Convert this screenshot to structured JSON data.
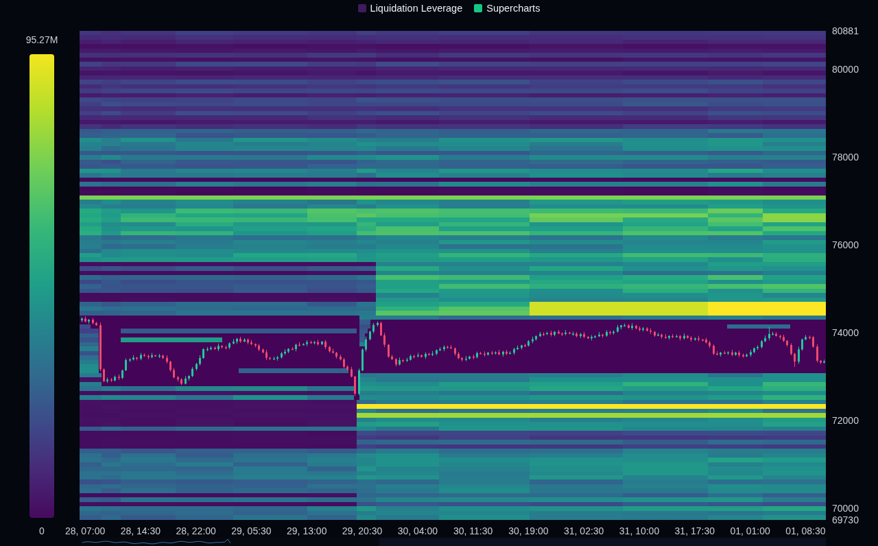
{
  "legend": {
    "items": [
      {
        "label": "Liquidation Leverage",
        "color": "#3f1a5e",
        "on": true
      },
      {
        "label": "Supercharts",
        "color": "#16c784",
        "on": true
      }
    ]
  },
  "color_scale": {
    "max_label": "95.27M",
    "min_label": "0"
  },
  "chart": {
    "chart_data": {
      "type": "candlestick",
      "ylim": [
        69730,
        80881
      ],
      "yticks": [
        80881,
        80000,
        78000,
        76000,
        74000,
        72000,
        70000,
        69730
      ],
      "categories": [
        null,
        "28, 07:00",
        null,
        null,
        null,
        null,
        null,
        null,
        null,
        null,
        null,
        null,
        null,
        null,
        null,
        null,
        "28, 14:30",
        null,
        null,
        null,
        null,
        null,
        null,
        null,
        null,
        null,
        null,
        null,
        null,
        null,
        null,
        "28, 22:00",
        null,
        null,
        null,
        null,
        null,
        null,
        null,
        null,
        null,
        null,
        null,
        null,
        null,
        null,
        "29, 05:30",
        null,
        null,
        null,
        null,
        null,
        null,
        null,
        null,
        null,
        null,
        null,
        null,
        null,
        null,
        "29, 13:00",
        null,
        null,
        null,
        null,
        null,
        null,
        null,
        null,
        null,
        null,
        null,
        null,
        null,
        null,
        "29, 20:30",
        null,
        null,
        null,
        null,
        null,
        null,
        null,
        null,
        null,
        null,
        null,
        null,
        null,
        null,
        "30, 04:00",
        null,
        null,
        null,
        null,
        null,
        null,
        null,
        null,
        null,
        null,
        null,
        null,
        null,
        null,
        "30, 11:30",
        null,
        null,
        null,
        null,
        null,
        null,
        null,
        null,
        null,
        null,
        null,
        null,
        null,
        null,
        "30, 19:00",
        null,
        null,
        null,
        null,
        null,
        null,
        null,
        null,
        null,
        null,
        null,
        null,
        null,
        null,
        "31, 02:30",
        null,
        null,
        null,
        null,
        null,
        null,
        null,
        null,
        null,
        null,
        null,
        null,
        null,
        null,
        "31, 10:00",
        null,
        null,
        null,
        null,
        null,
        null,
        null,
        null,
        null,
        null,
        null,
        null,
        null,
        null,
        "31, 17:30",
        null,
        null,
        null,
        null,
        null,
        null,
        null,
        null,
        null,
        null,
        null,
        null,
        null,
        null,
        "01, 01:00",
        null,
        null,
        null,
        null,
        null,
        null,
        null,
        null,
        null,
        null,
        null,
        null,
        null,
        null,
        "01, 08:30",
        null,
        null,
        null,
        null,
        null
      ],
      "ohlc": [
        [
          74280,
          74350,
          74245,
          74320
        ],
        [
          74320,
          74375,
          74235,
          74255
        ],
        [
          74255,
          74310,
          74205,
          74295
        ],
        [
          74295,
          74335,
          74190,
          74220
        ],
        [
          74220,
          74245,
          74155,
          74170
        ],
        [
          74170,
          74230,
          73120,
          73165
        ],
        [
          73165,
          73185,
          72870,
          72895
        ],
        [
          72895,
          72977,
          72855,
          72932
        ],
        [
          72932,
          72967,
          72875,
          72910
        ],
        [
          72910,
          73023,
          72890,
          72993
        ],
        [
          72993,
          73048,
          72920,
          72970
        ],
        [
          72970,
          73155,
          72940,
          73140
        ],
        [
          73140,
          73415,
          73125,
          73375
        ],
        [
          73375,
          73414,
          73330,
          73389
        ],
        [
          73389,
          73488,
          73364,
          73428
        ],
        [
          73428,
          73448,
          73367,
          73407
        ],
        [
          73407,
          73536,
          73372,
          73491
        ],
        [
          73491,
          73526,
          73450,
          73470
        ],
        [
          73470,
          73500,
          73394,
          73444
        ],
        [
          73444,
          73538,
          73414,
          73483
        ],
        [
          73483,
          73498,
          73452,
          73467
        ],
        [
          73467,
          73516,
          73422,
          73476
        ],
        [
          73476,
          73501,
          73400,
          73425
        ],
        [
          73425,
          73485,
          73298,
          73338
        ],
        [
          73338,
          73358,
          73112,
          73147
        ],
        [
          73147,
          73192,
          72960,
          72980
        ],
        [
          72980,
          73015,
          72885,
          72935
        ],
        [
          72935,
          72965,
          72805,
          72835
        ],
        [
          72835,
          73008,
          72820,
          72953
        ],
        [
          72953,
          73027,
          72908,
          73012
        ],
        [
          73012,
          73215,
          72987,
          73175
        ],
        [
          73175,
          73312,
          73135,
          73287
        ],
        [
          73287,
          73483,
          73252,
          73423
        ],
        [
          73423,
          73645,
          73403,
          73625
        ],
        [
          73625,
          73673,
          73575,
          73628
        ],
        [
          73628,
          73692,
          73598,
          73657
        ],
        [
          73657,
          73687,
          73610,
          73625
        ],
        [
          73625,
          73753,
          73580,
          73698
        ],
        [
          73698,
          73713,
          73642,
          73667
        ],
        [
          73667,
          73707,
          73620,
          73660
        ],
        [
          73660,
          73780,
          73625,
          73755
        ],
        [
          73755,
          73855,
          73735,
          73795
        ],
        [
          73795,
          73880,
          73745,
          73860
        ],
        [
          73860,
          73905,
          73767,
          73797
        ],
        [
          73797,
          73875,
          73782,
          73840
        ],
        [
          73840,
          73870,
          73732,
          73777
        ],
        [
          73777,
          73832,
          73715,
          73740
        ],
        [
          73740,
          73755,
          73665,
          73705
        ],
        [
          73705,
          73745,
          73580,
          73615
        ],
        [
          73615,
          73640,
          73530,
          73550
        ],
        [
          73550,
          73610,
          73375,
          73425
        ],
        [
          73425,
          73445,
          73375,
          73405
        ],
        [
          73405,
          73453,
          73390,
          73408
        ],
        [
          73408,
          73471,
          73363,
          73436
        ],
        [
          73436,
          73559,
          73411,
          73529
        ],
        [
          73529,
          73622,
          73489,
          73567
        ],
        [
          73567,
          73645,
          73532,
          73630
        ],
        [
          73630,
          73670,
          73605,
          73625
        ],
        [
          73625,
          73750,
          73575,
          73725
        ],
        [
          73725,
          73785,
          73690,
          73720
        ],
        [
          73720,
          73760,
          73705,
          73740
        ],
        [
          73740,
          73828,
          73695,
          73783
        ],
        [
          73783,
          73818,
          73746,
          73771
        ],
        [
          73771,
          73814,
          73731,
          73784
        ],
        [
          73784,
          73839,
          73702,
          73737
        ],
        [
          73737,
          73810,
          73717,
          73795
        ],
        [
          73795,
          73835,
          73622,
          73672
        ],
        [
          73672,
          73697,
          73544,
          73574
        ],
        [
          73574,
          73634,
          73526,
          73541
        ],
        [
          73541,
          73561,
          73408,
          73453
        ],
        [
          73453,
          73498,
          73365,
          73390
        ],
        [
          73390,
          73425,
          73185,
          73225
        ],
        [
          73225,
          73255,
          73130,
          73165
        ],
        [
          73165,
          73220,
          72980,
          73000
        ],
        [
          73000,
          73015,
          72560,
          72610
        ],
        [
          72610,
          73180,
          72580,
          73140
        ],
        [
          73140,
          73640,
          73125,
          73615
        ],
        [
          73615,
          73910,
          73570,
          73850
        ],
        [
          73850,
          74045,
          73825,
          74025
        ],
        [
          74025,
          74220,
          73985,
          74175
        ],
        [
          74175,
          74255,
          74140,
          74220
        ],
        [
          74220,
          74250,
          73920,
          73940
        ],
        [
          73940,
          73995,
          73675,
          73725
        ],
        [
          73725,
          73740,
          73425,
          73455
        ],
        [
          73455,
          73495,
          73380,
          73395
        ],
        [
          73395,
          73420,
          73230,
          73275
        ],
        [
          73275,
          73433,
          73250,
          73373
        ],
        [
          73373,
          73393,
          73325,
          73365
        ],
        [
          73365,
          73427,
          73330,
          73382
        ],
        [
          73382,
          73500,
          73362,
          73465
        ],
        [
          73465,
          73495,
          73413,
          73463
        ],
        [
          73463,
          73540,
          73433,
          73485
        ],
        [
          73485,
          73500,
          73432,
          73447
        ],
        [
          73447,
          73555,
          73402,
          73515
        ],
        [
          73515,
          73540,
          73480,
          73505
        ],
        [
          73505,
          73580,
          73465,
          73520
        ],
        [
          73520,
          73620,
          73485,
          73600
        ],
        [
          73600,
          73670,
          73580,
          73625
        ],
        [
          73625,
          73710,
          73575,
          73675
        ],
        [
          73675,
          73705,
          73635,
          73665
        ],
        [
          73665,
          73720,
          73630,
          73645
        ],
        [
          73645,
          73660,
          73475,
          73520
        ],
        [
          73520,
          73560,
          73395,
          73420
        ],
        [
          73420,
          73445,
          73345,
          73385
        ],
        [
          73385,
          73467,
          73350,
          73407
        ],
        [
          73407,
          73474,
          73387,
          73454
        ],
        [
          73454,
          73499,
          73391,
          73441
        ],
        [
          73441,
          73568,
          73411,
          73533
        ],
        [
          73533,
          73563,
          73505,
          73520
        ],
        [
          73520,
          73575,
          73455,
          73500
        ],
        [
          73500,
          73560,
          73475,
          73545
        ],
        [
          73545,
          73585,
          73495,
          73535
        ],
        [
          73535,
          73575,
          73500,
          73550
        ],
        [
          73550,
          73610,
          73485,
          73505
        ],
        [
          73505,
          73585,
          73455,
          73565
        ],
        [
          73565,
          73610,
          73490,
          73520
        ],
        [
          73520,
          73575,
          73505,
          73540
        ],
        [
          73540,
          73655,
          73495,
          73625
        ],
        [
          73625,
          73710,
          73600,
          73655
        ],
        [
          73655,
          73725,
          73615,
          73710
        ],
        [
          73710,
          73750,
          73670,
          73705
        ],
        [
          73705,
          73830,
          73685,
          73805
        ],
        [
          73805,
          73910,
          73755,
          73850
        ],
        [
          73850,
          73940,
          73820,
          73920
        ],
        [
          73920,
          74017,
          73905,
          73972
        ],
        [
          73972,
          74007,
          73924,
          73969
        ],
        [
          73969,
          74021,
          73944,
          73991
        ],
        [
          73991,
          74046,
          73913,
          73953
        ],
        [
          73953,
          74035,
          73918,
          74020
        ],
        [
          74020,
          74060,
          73962,
          73982
        ],
        [
          73982,
          74007,
          73920,
          73970
        ],
        [
          73970,
          74061,
          73940,
          74001
        ],
        [
          74001,
          74021,
          73962,
          73977
        ],
        [
          73977,
          74023,
          73932,
          73978
        ],
        [
          73978,
          74013,
          73894,
          73919
        ],
        [
          73919,
          73995,
          73879,
          73965
        ],
        [
          73965,
          74020,
          73871,
          73906
        ],
        [
          73906,
          73921,
          73852,
          73872
        ],
        [
          73872,
          73945,
          73822,
          73905
        ],
        [
          73905,
          73942,
          73875,
          73917
        ],
        [
          73917,
          74014,
          73902,
          73954
        ],
        [
          73954,
          73974,
          73886,
          73931
        ],
        [
          73931,
          74058,
          73906,
          74013
        ],
        [
          74013,
          74048,
          73950,
          73990
        ],
        [
          73990,
          74053,
          73955,
          74023
        ],
        [
          74023,
          74177,
          74003,
          74122
        ],
        [
          74122,
          74180,
          74072,
          74165
        ],
        [
          74165,
          74207,
          74135,
          74167
        ],
        [
          74167,
          74192,
          74094,
          74109
        ],
        [
          74109,
          74216,
          74064,
          74156
        ],
        [
          74156,
          74176,
          74073,
          74098
        ],
        [
          74098,
          74143,
          74025,
          74065
        ],
        [
          74065,
          74130,
          74030,
          74095
        ],
        [
          74095,
          74125,
          74025,
          74045
        ],
        [
          74045,
          74100,
          73970,
          74020
        ],
        [
          74020,
          74035,
          73905,
          73935
        ],
        [
          73935,
          73995,
          73920,
          73955
        ],
        [
          73955,
          73980,
          73861,
          73906
        ],
        [
          73906,
          73966,
          73857,
          73882
        ],
        [
          73882,
          73943,
          73842,
          73923
        ],
        [
          73923,
          73968,
          73874,
          73909
        ],
        [
          73909,
          73955,
          73889,
          73920
        ],
        [
          73920,
          73950,
          73821,
          73871
        ],
        [
          73871,
          73982,
          73841,
          73927
        ],
        [
          73927,
          73942,
          73865,
          73880
        ],
        [
          73880,
          73920,
          73797,
          73842
        ],
        [
          73842,
          73894,
          73817,
          73869
        ],
        [
          73869,
          73929,
          73801,
          73841
        ],
        [
          73841,
          73861,
          73803,
          73838
        ],
        [
          73838,
          73883,
          73755,
          73775
        ],
        [
          73775,
          73810,
          73650,
          73700
        ],
        [
          73700,
          73730,
          73490,
          73520
        ],
        [
          73520,
          73575,
          73485,
          73500
        ],
        [
          73500,
          73560,
          73455,
          73545
        ],
        [
          73545,
          73585,
          73510,
          73535
        ],
        [
          73535,
          73575,
          73495,
          73550
        ],
        [
          73550,
          73610,
          73460,
          73495
        ],
        [
          73495,
          73565,
          73475,
          73545
        ],
        [
          73545,
          73590,
          73440,
          73490
        ],
        [
          73490,
          73525,
          73430,
          73460
        ],
        [
          73460,
          73525,
          73445,
          73495
        ],
        [
          73495,
          73612,
          73450,
          73557
        ],
        [
          73557,
          73660,
          73532,
          73645
        ],
        [
          73645,
          73712,
          73605,
          73672
        ],
        [
          73672,
          73830,
          73637,
          73805
        ],
        [
          73805,
          73935,
          73785,
          73875
        ],
        [
          73875,
          74130,
          73825,
          73970
        ],
        [
          73970,
          74020,
          73940,
          73975
        ],
        [
          73975,
          74010,
          73910,
          73925
        ],
        [
          73925,
          73955,
          73855,
          73900
        ],
        [
          73900,
          73955,
          73790,
          73815
        ],
        [
          73815,
          73830,
          73678,
          73718
        ],
        [
          73718,
          73758,
          73482,
          73517
        ],
        [
          73517,
          73542,
          73220,
          73340
        ],
        [
          73340,
          73680,
          73290,
          73620
        ],
        [
          73620,
          73865,
          73590,
          73845
        ],
        [
          73845,
          73945,
          73830,
          73900
        ],
        [
          73900,
          73935,
          73850,
          73895
        ],
        [
          73895,
          73925,
          73655,
          73680
        ],
        [
          73680,
          73735,
          73320,
          73360
        ],
        [
          73360,
          73375,
          73285,
          73320
        ],
        [
          73320,
          73385,
          73300,
          73345
        ]
      ]
    }
  }
}
